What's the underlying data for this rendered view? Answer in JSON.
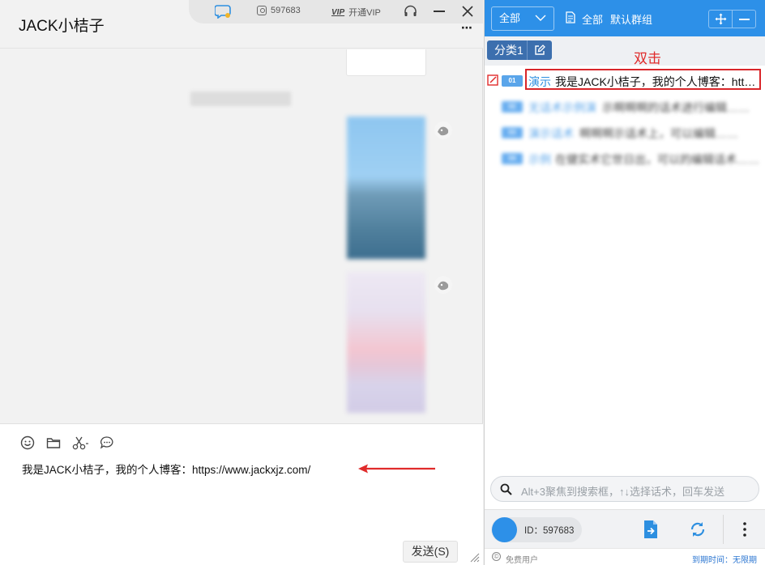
{
  "chat": {
    "title": "JACK小桔子",
    "more_icon": "more-dots-icon",
    "topbar": {
      "user_id": "597683",
      "vip_tag": "VIP",
      "vip_label": "开通VIP"
    },
    "input_text": "我是JACK小桔子，我的个人博客：https://www.jackxjz.com/",
    "send_label": "发送(S)",
    "tools": [
      "emoji-icon",
      "folder-icon",
      "scissors-icon",
      "bubble-icon"
    ]
  },
  "panel": {
    "dropdown_value": "全部",
    "filter_all": "全部",
    "filter_group": "默认群组",
    "category_tab": "分类1",
    "annotation": "双击",
    "rows": [
      {
        "num": "01",
        "tag": "演示",
        "text": "我是JACK小桔子，我的个人博客：htt…"
      },
      {
        "num": "02",
        "tag": "无话术示例演",
        "text": "示啊啊啊的话术进行编辑……"
      },
      {
        "num": "03",
        "tag": "演示话术",
        "text": "啊啊啊示话术上，可以编辑……"
      },
      {
        "num": "04",
        "tag": "示例",
        "text": "在健实术它世日出，可以的编辑话术……"
      }
    ],
    "search_placeholder": "Alt+3聚焦到搜索框，↑↓选择话术，回车发送",
    "id_label": "ID：597683",
    "footer_free": "免费用户",
    "footer_expiry": "到期时间：无限期",
    "colors": {
      "accent": "#2d90e8",
      "highlight": "#d9262a",
      "tab": "#3c6fae"
    }
  }
}
